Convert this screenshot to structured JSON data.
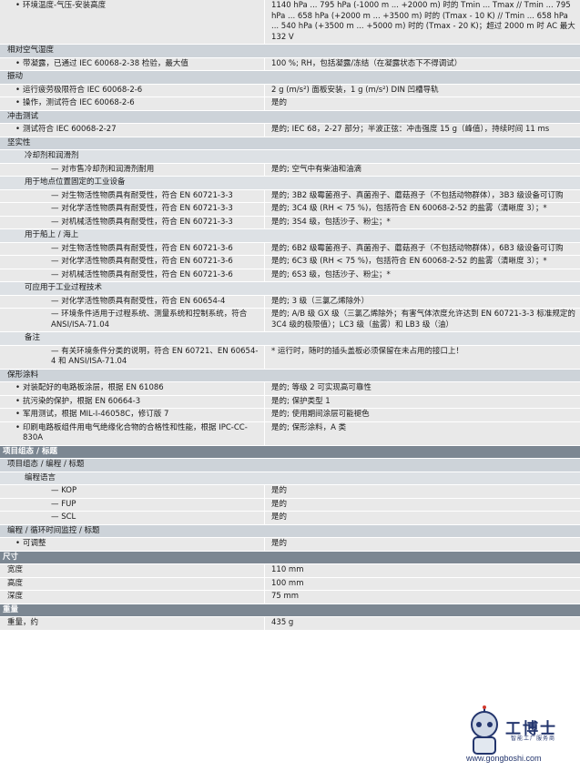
{
  "rows": [
    {
      "t": "item",
      "l": "环境温度-气压-安装高度",
      "r": "1140 hPa ... 795 hPa (-1000 m ... +2000 m) 时的 Tmin ... Tmax // Tmin ... 795 hPa ... 658 hPa (+2000 m ... +3500 m) 时的 (Tmax - 10 K) // Tmin ... 658 hPa ... 540 hPa (+3500 m ... +5000 m) 时的 (Tmax - 20 K)；超过 2000 m 时 AC 最大 132 V",
      "lv": 1
    },
    {
      "t": "sec",
      "l": "相对空气湿度"
    },
    {
      "t": "item",
      "l": "带凝露，已通过 IEC 60068-2-38 检验，最大值",
      "r": "100 %; RH，包括凝露/冻结（在凝露状态下不得调试）",
      "lv": 1
    },
    {
      "t": "sec",
      "l": "振动"
    },
    {
      "t": "item",
      "l": "运行疲劳极限符合 IEC 60068-2-6",
      "r": "2 g (m/s²) 面板安装，1 g (m/s²) DIN 凹槽导轨",
      "lv": 1
    },
    {
      "t": "item",
      "l": "操作，测试符合 IEC 60068-2-6",
      "r": "是的",
      "lv": 1
    },
    {
      "t": "sec",
      "l": "冲击测试"
    },
    {
      "t": "item",
      "l": "测试符合 IEC 60068-2-27",
      "r": "是的; IEC 68，2-27 部分；半波正弦：冲击强度 15 g（峰值），持续时间 11 ms",
      "lv": 1
    },
    {
      "t": "sec",
      "l": "坚实性"
    },
    {
      "t": "sub",
      "l": "冷却剂和润滑剂"
    },
    {
      "t": "item",
      "l": "— 对市售冷却剂和润滑剂耐用",
      "r": "是的; 空气中有柴油和油滴",
      "lv": 2
    },
    {
      "t": "sub",
      "l": "用于地点位置固定的工业设备"
    },
    {
      "t": "item",
      "l": "— 对生物活性物质具有耐受性，符合 EN 60721-3-3",
      "r": "是的; 3B2 级霉菌孢子、真菌孢子、蘑菇孢子（不包括动物群体），3B3 级设备可订购",
      "lv": 2
    },
    {
      "t": "item",
      "l": "— 对化学活性物质具有耐受性，符合 EN 60721-3-3",
      "r": "是的; 3C4 级 (RH < 75 %)，包括符合 EN 60068-2-52 的盐雾（清晰度 3）；*",
      "lv": 2
    },
    {
      "t": "item",
      "l": "— 对机械活性物质具有耐受性，符合 EN 60721-3-3",
      "r": "是的; 3S4 级，包括沙子、粉尘；*",
      "lv": 2
    },
    {
      "t": "sub",
      "l": "用于船上 / 海上"
    },
    {
      "t": "item",
      "l": "— 对生物活性物质具有耐受性，符合 EN 60721-3-6",
      "r": "是的; 6B2 级霉菌孢子、真菌孢子、蘑菇孢子（不包括动物群体），6B3 级设备可订购",
      "lv": 2
    },
    {
      "t": "item",
      "l": "— 对化学活性物质具有耐受性，符合 EN 60721-3-6",
      "r": "是的; 6C3 级 (RH < 75 %)，包括符合 EN 60068-2-52 的盐雾（清晰度 3）；*",
      "lv": 2
    },
    {
      "t": "item",
      "l": "— 对机械活性物质具有耐受性，符合 EN 60721-3-6",
      "r": "是的; 6S3 级，包括沙子、粉尘；*",
      "lv": 2
    },
    {
      "t": "sub",
      "l": "可应用于工业过程技术"
    },
    {
      "t": "item",
      "l": "— 对化学活性物质具有耐受性，符合 EN 60654-4",
      "r": "是的; 3 级（三氯乙烯除外）",
      "lv": 2
    },
    {
      "t": "item",
      "l": "— 环境条件适用于过程系统、测量系统和控制系统，符合 ANSI/ISA-71.04",
      "r": "是的; A/B 级 GX 级（三氯乙烯除外；有害气体浓度允许达到 EN 60721-3-3 标准规定的 3C4 级的极限值）；LC3 级（盐雾）和 LB3 级（油）",
      "lv": 2
    },
    {
      "t": "sub",
      "l": "备注"
    },
    {
      "t": "item",
      "l": "— 有关环境条件分类的说明，符合 EN 60721、EN 60654-4 和 ANSI/ISA-71.04",
      "r": "* 运行时，随时的插头盖板必须保留在未占用的接口上！",
      "lv": 2
    },
    {
      "t": "sec",
      "l": "保形涂料"
    },
    {
      "t": "item",
      "l": "对装配好的电路板涂层，根据 EN 61086",
      "r": "是的; 等级 2 可实现高可靠性",
      "lv": 1
    },
    {
      "t": "item",
      "l": "抗污染的保护，根据 EN 60664-3",
      "r": "是的; 保护类型 1",
      "lv": 1
    },
    {
      "t": "item",
      "l": "军用测试，根据 MIL-I-46058C，修订版 7",
      "r": "是的; 使用期间涂层可能褪色",
      "lv": 1
    },
    {
      "t": "item",
      "l": "印刷电路板组件用电气绝缘化合物的合格性和性能，根据 IPC-CC-830A",
      "r": "是的; 保形涂料，A 类",
      "lv": 1
    },
    {
      "t": "major",
      "l": "项目组态 / 标题"
    },
    {
      "t": "sec",
      "l": "项目组态 / 编程 / 标题"
    },
    {
      "t": "sub",
      "l": "编程语言"
    },
    {
      "t": "item",
      "l": "— KOP",
      "r": "是的",
      "lv": 2
    },
    {
      "t": "item",
      "l": "— FUP",
      "r": "是的",
      "lv": 2
    },
    {
      "t": "item",
      "l": "— SCL",
      "r": "是的",
      "lv": 2
    },
    {
      "t": "sec",
      "l": "编程 / 循环时间监控 / 标题"
    },
    {
      "t": "item",
      "l": "可调整",
      "r": "是的",
      "lv": 1
    },
    {
      "t": "major",
      "l": "尺寸"
    },
    {
      "t": "item",
      "l": "宽度",
      "r": "110 mm",
      "lv": 0
    },
    {
      "t": "item",
      "l": "高度",
      "r": "100 mm",
      "lv": 0
    },
    {
      "t": "item",
      "l": "深度",
      "r": "75 mm",
      "lv": 0
    },
    {
      "t": "major",
      "l": "重量"
    },
    {
      "t": "item",
      "l": "重量，约",
      "r": "435 g",
      "lv": 0
    }
  ],
  "watermark": {
    "title": "工博士",
    "subtitle": "智能工厂服务商",
    "url": "www.gongboshi.com"
  }
}
